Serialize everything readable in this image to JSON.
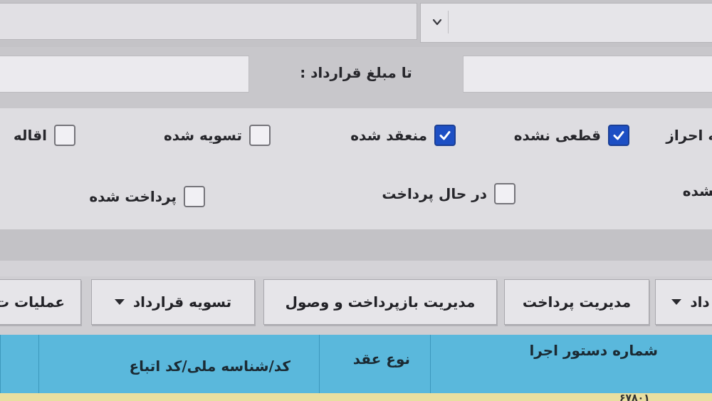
{
  "filters": {
    "amount_to_label": "تا مبلغ قرارداد :",
    "checkboxes": [
      {
        "label": "به احراز",
        "checked": false
      },
      {
        "label": "قطعی نشده",
        "checked": true
      },
      {
        "label": "منعقد شده",
        "checked": true
      },
      {
        "label": "تسویه شده",
        "checked": false
      },
      {
        "label": "اقاله",
        "checked": false
      },
      {
        "label": "نشده",
        "checked": false
      },
      {
        "label": "در حال پرداخت",
        "checked": false
      },
      {
        "label": "پرداخت شده",
        "checked": false
      }
    ]
  },
  "toolbar": {
    "contract_menu": "داد",
    "payment_management": "مدیریت پرداخت",
    "repayment_collection": "مدیریت بازپرداخت و وصول",
    "settle_contract": "تسویه قرارداد",
    "operations": "عملیات ت"
  },
  "table": {
    "headers": [
      "شماره دستور اجرا",
      "نوع عقد",
      "کد/شناسه ملی/کد اتباع"
    ],
    "first_row_peek": "۶۷۸۰۱"
  },
  "colors": {
    "accent_blue": "#1d4fc4",
    "table_header": "#5ab8dc",
    "row_highlight": "#e9dfa0"
  }
}
